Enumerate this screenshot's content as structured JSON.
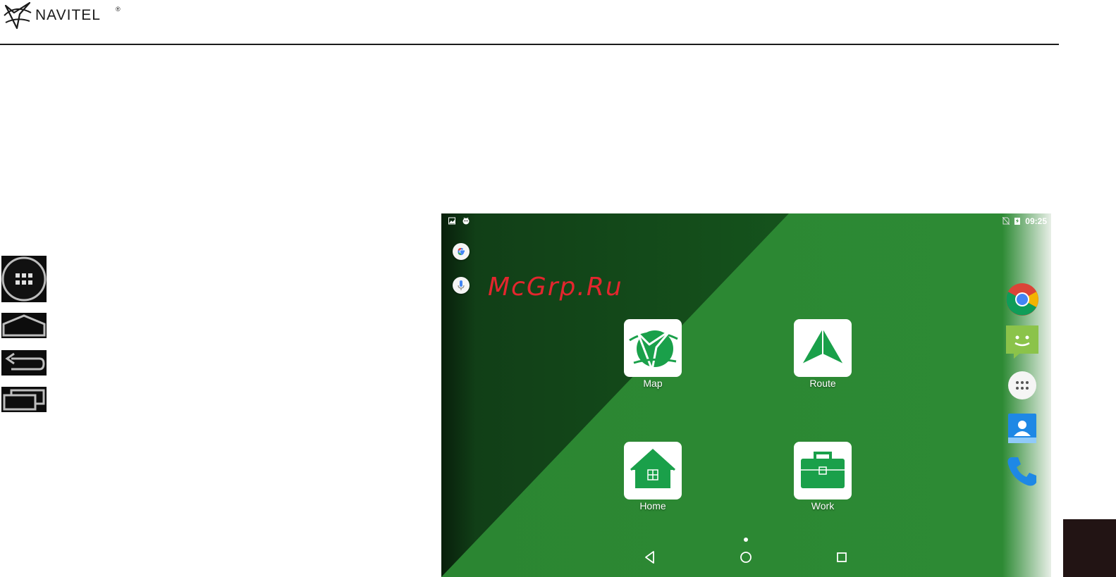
{
  "header": {
    "brand": "NAVITEL",
    "reg_mark": "®"
  },
  "screen": {
    "status_bar": {
      "time": "09:25",
      "left_icons": [
        "image-icon",
        "android-icon"
      ],
      "right_icons": [
        "no-sim-icon",
        "battery-charging-icon"
      ]
    },
    "widgets": [
      "google-search-icon",
      "microphone-icon"
    ],
    "watermark": "McGrp.Ru",
    "apps": [
      {
        "label": "Map",
        "icon": "navitel-map-icon"
      },
      {
        "label": "Route",
        "icon": "route-arrow-icon"
      },
      {
        "label": "Home",
        "icon": "home-icon"
      },
      {
        "label": "Work",
        "icon": "briefcase-icon"
      }
    ],
    "dock": [
      "chrome-icon",
      "messaging-icon",
      "app-drawer-icon",
      "contacts-icon",
      "phone-icon"
    ],
    "nav_bar": [
      "back-icon",
      "home-circle-icon",
      "recents-icon"
    ]
  },
  "legend_icons": [
    "all-apps-icon",
    "home-key-icon",
    "back-key-icon",
    "recent-apps-key-icon"
  ],
  "colors": {
    "accent_green": "#2d8a34",
    "dark_green": "#0f3a14",
    "app_green": "#1aa04a",
    "watermark_red": "#e3262e"
  }
}
